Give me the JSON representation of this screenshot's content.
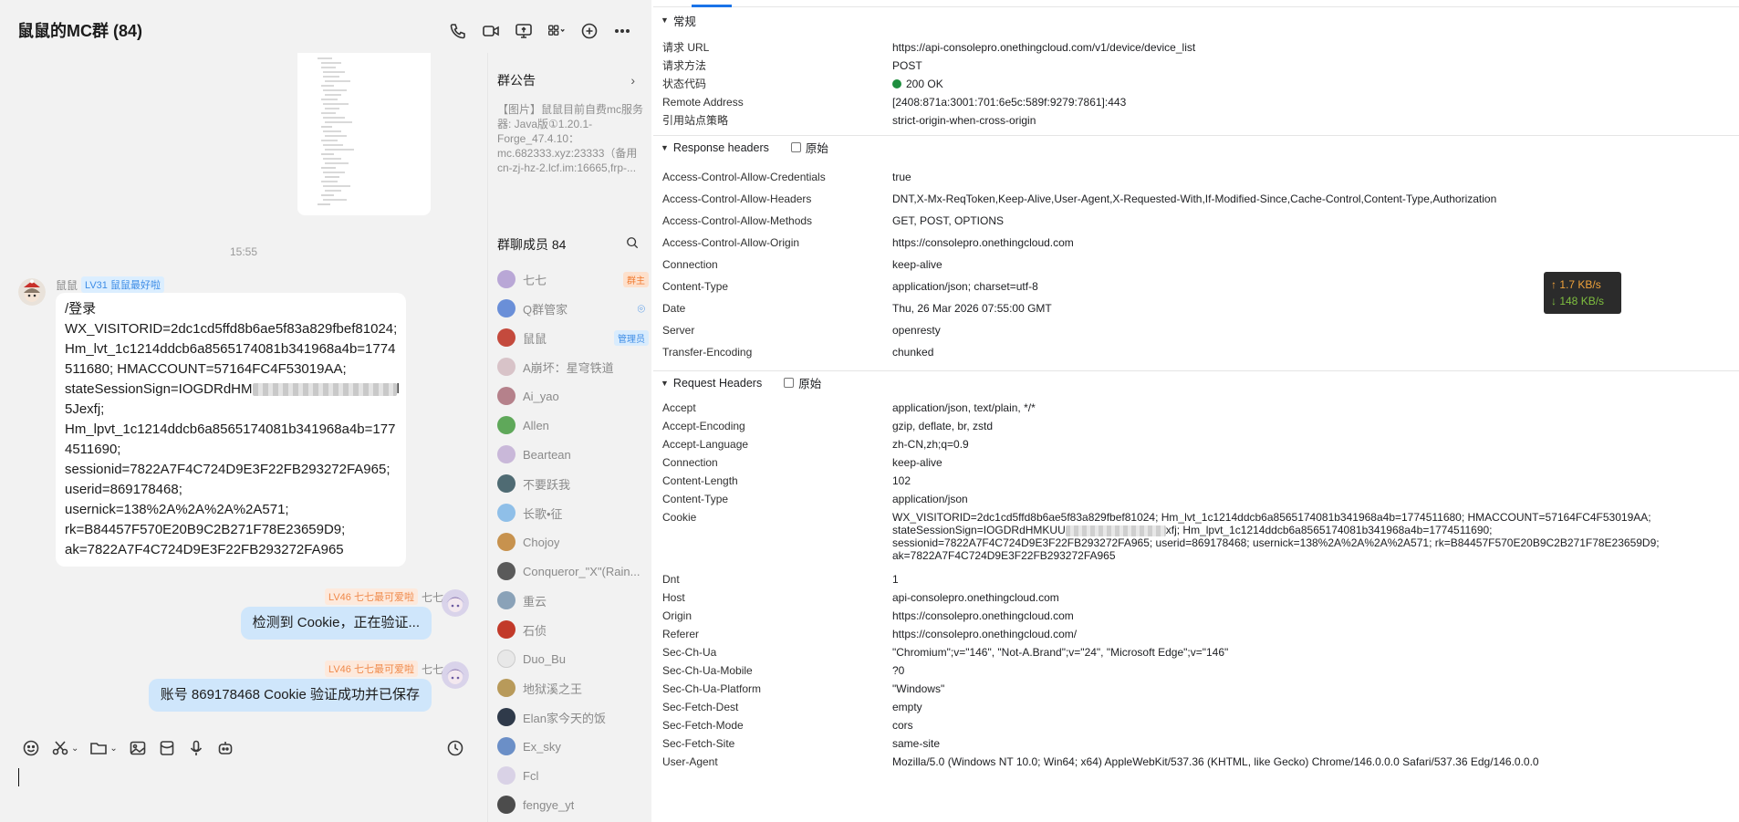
{
  "chat": {
    "title": "鼠鼠的MC群 (84)",
    "timestamp": "15:55",
    "messages": {
      "first": {
        "sender": "鼠鼠",
        "badge": "LV31 鼠鼠最好啦",
        "lines": [
          "/登录",
          "WX_VISITORID=2dc1cd5ffd8b6ae5f83a829fbef81024;",
          "Hm_lvt_1c1214ddcb6a8565174081b341968a4b=1774",
          "511680; HMACCOUNT=57164FC4F53019AA;",
          "stateSessionSign=IOGDRdHM",
          "l",
          "5Jexfj;",
          "Hm_lpvt_1c1214ddcb6a8565174081b341968a4b=177",
          "4511690;",
          "sessionid=7822A7F4C724D9E3F22FB293272FA965;",
          "userid=869178468;",
          "usernick=138%2A%2A%2A%2A571;",
          "rk=B84457F570E20B9C2B271F78E23659D9;",
          "ak=7822A7F4C724D9E3F22FB293272FA965"
        ]
      },
      "second": {
        "sender": "七七",
        "badge": "LV46 七七最可爱啦",
        "text": "检测到 Cookie，正在验证..."
      },
      "third": {
        "sender": "七七",
        "badge": "LV46 七七最可爱啦",
        "text": "账号 869178468 Cookie 验证成功并已保存"
      }
    }
  },
  "side": {
    "notice_title": "群公告",
    "notice_text": "【图片】鼠鼠目前自费mc服务器: Java版①1.20.1-Forge_47.4.10：mc.682333.xyz:23333（备用cn-zj-hz-2.lcf.im:16665,frp-...",
    "members_title": "群聊成员 84",
    "members": [
      {
        "name": "七七",
        "tag": "群主",
        "color": "#b9a7d6"
      },
      {
        "name": "Q群管家",
        "tag": "",
        "color": "#6a8fd8"
      },
      {
        "name": "鼠鼠",
        "tag": "管理员",
        "color": "#c44a3d"
      },
      {
        "name": "A崩坏：星穹铁道",
        "tag": "",
        "color": "#d8c3c8"
      },
      {
        "name": "Ai_yao",
        "tag": "",
        "color": "#b5818b"
      },
      {
        "name": "Allen",
        "tag": "",
        "color": "#5fa85a"
      },
      {
        "name": "Beartean",
        "tag": "",
        "color": "#c9b8d9"
      },
      {
        "name": "不要跃我",
        "tag": "",
        "color": "#4f6b73"
      },
      {
        "name": "长歌•征",
        "tag": "",
        "color": "#8fbfe8"
      },
      {
        "name": "Chojoy",
        "tag": "",
        "color": "#c7924e"
      },
      {
        "name": "Conqueror_\"X\"(Rain...",
        "tag": "",
        "color": "#5a5a5a"
      },
      {
        "name": "重云",
        "tag": "",
        "color": "#8aa2b8"
      },
      {
        "name": "石侦",
        "tag": "",
        "color": "#c23a2a"
      },
      {
        "name": "Duo_Bu",
        "tag": "",
        "color": "#e8e8e8"
      },
      {
        "name": "地狱溪之王",
        "tag": "",
        "color": "#b89a5a"
      },
      {
        "name": "Elan家今天的饭",
        "tag": "",
        "color": "#2f3a4a"
      },
      {
        "name": "Ex_sky",
        "tag": "",
        "color": "#6b8fc7"
      },
      {
        "name": "Fcl",
        "tag": "",
        "color": "#d9d2e6"
      },
      {
        "name": "fengye_yt",
        "tag": "",
        "color": "#4c4c4c"
      }
    ]
  },
  "devtools": {
    "general": {
      "title": "常规",
      "rows": [
        {
          "k": "请求 URL",
          "v": "https://api-consolepro.onethingcloud.com/v1/device/device_list"
        },
        {
          "k": "请求方法",
          "v": "POST"
        },
        {
          "k": "状态代码",
          "v": "200 OK"
        },
        {
          "k": "Remote Address",
          "v": "[2408:871a:3001:701:6e5c:589f:9279:7861]:443"
        },
        {
          "k": "引用站点策略",
          "v": "strict-origin-when-cross-origin"
        }
      ]
    },
    "response": {
      "title": "Response headers",
      "raw_label": "原始",
      "rows": [
        {
          "k": "Access-Control-Allow-Credentials",
          "v": "true"
        },
        {
          "k": "Access-Control-Allow-Headers",
          "v": "DNT,X-Mx-ReqToken,Keep-Alive,User-Agent,X-Requested-With,If-Modified-Since,Cache-Control,Content-Type,Authorization"
        },
        {
          "k": "Access-Control-Allow-Methods",
          "v": "GET, POST, OPTIONS"
        },
        {
          "k": "Access-Control-Allow-Origin",
          "v": "https://consolepro.onethingcloud.com"
        },
        {
          "k": "Connection",
          "v": "keep-alive"
        },
        {
          "k": "Content-Type",
          "v": "application/json; charset=utf-8"
        },
        {
          "k": "Date",
          "v": "Thu, 26 Mar 2026 07:55:00 GMT"
        },
        {
          "k": "Server",
          "v": "openresty"
        },
        {
          "k": "Transfer-Encoding",
          "v": "chunked"
        }
      ]
    },
    "request": {
      "title": "Request Headers",
      "raw_label": "原始",
      "rows": [
        {
          "k": "Accept",
          "v": "application/json, text/plain, */*"
        },
        {
          "k": "Accept-Encoding",
          "v": "gzip, deflate, br, zstd"
        },
        {
          "k": "Accept-Language",
          "v": "zh-CN,zh;q=0.9"
        },
        {
          "k": "Connection",
          "v": "keep-alive"
        },
        {
          "k": "Content-Length",
          "v": "102"
        },
        {
          "k": "Content-Type",
          "v": "application/json"
        },
        {
          "k": "Cookie",
          "v": ""
        },
        {
          "k": "Dnt",
          "v": "1"
        },
        {
          "k": "Host",
          "v": "api-consolepro.onethingcloud.com"
        },
        {
          "k": "Origin",
          "v": "https://consolepro.onethingcloud.com"
        },
        {
          "k": "Referer",
          "v": "https://consolepro.onethingcloud.com/"
        },
        {
          "k": "Sec-Ch-Ua",
          "v": "\"Chromium\";v=\"146\", \"Not-A.Brand\";v=\"24\", \"Microsoft Edge\";v=\"146\""
        },
        {
          "k": "Sec-Ch-Ua-Mobile",
          "v": "?0"
        },
        {
          "k": "Sec-Ch-Ua-Platform",
          "v": "\"Windows\""
        },
        {
          "k": "Sec-Fetch-Dest",
          "v": "empty"
        },
        {
          "k": "Sec-Fetch-Mode",
          "v": "cors"
        },
        {
          "k": "Sec-Fetch-Site",
          "v": "same-site"
        },
        {
          "k": "User-Agent",
          "v": "Mozilla/5.0 (Windows NT 10.0; Win64; x64) AppleWebKit/537.36 (KHTML, like Gecko) Chrome/146.0.0.0 Safari/537.36 Edg/146.0.0.0"
        }
      ],
      "cookie_lines": [
        "WX_VISITORID=2dc1cd5ffd8b6ae5f83a829fbef81024; Hm_lvt_1c1214ddcb6a8565174081b341968a4b=1774511680; HMACCOUNT=57164FC4F53019AA;",
        "stateSessionSign=IOGDRdHMKUU",
        "xfj; Hm_lpvt_1c1214ddcb6a8565174081b341968a4b=1774511690;",
        "sessionid=7822A7F4C724D9E3F22FB293272FA965; userid=869178468; usernick=138%2A%2A%2A%2A571; rk=B84457F570E20B9C2B271F78E23659D9;",
        "ak=7822A7F4C724D9E3F22FB293272FA965"
      ]
    }
  },
  "net_widget": {
    "up": "↑ 1.7 KB/s",
    "down": "↓ 148 KB/s"
  },
  "colors": {
    "status_ok": "#1e8e3e",
    "bubble_self": "#cfe6fb",
    "accent": "#1a73e8"
  }
}
